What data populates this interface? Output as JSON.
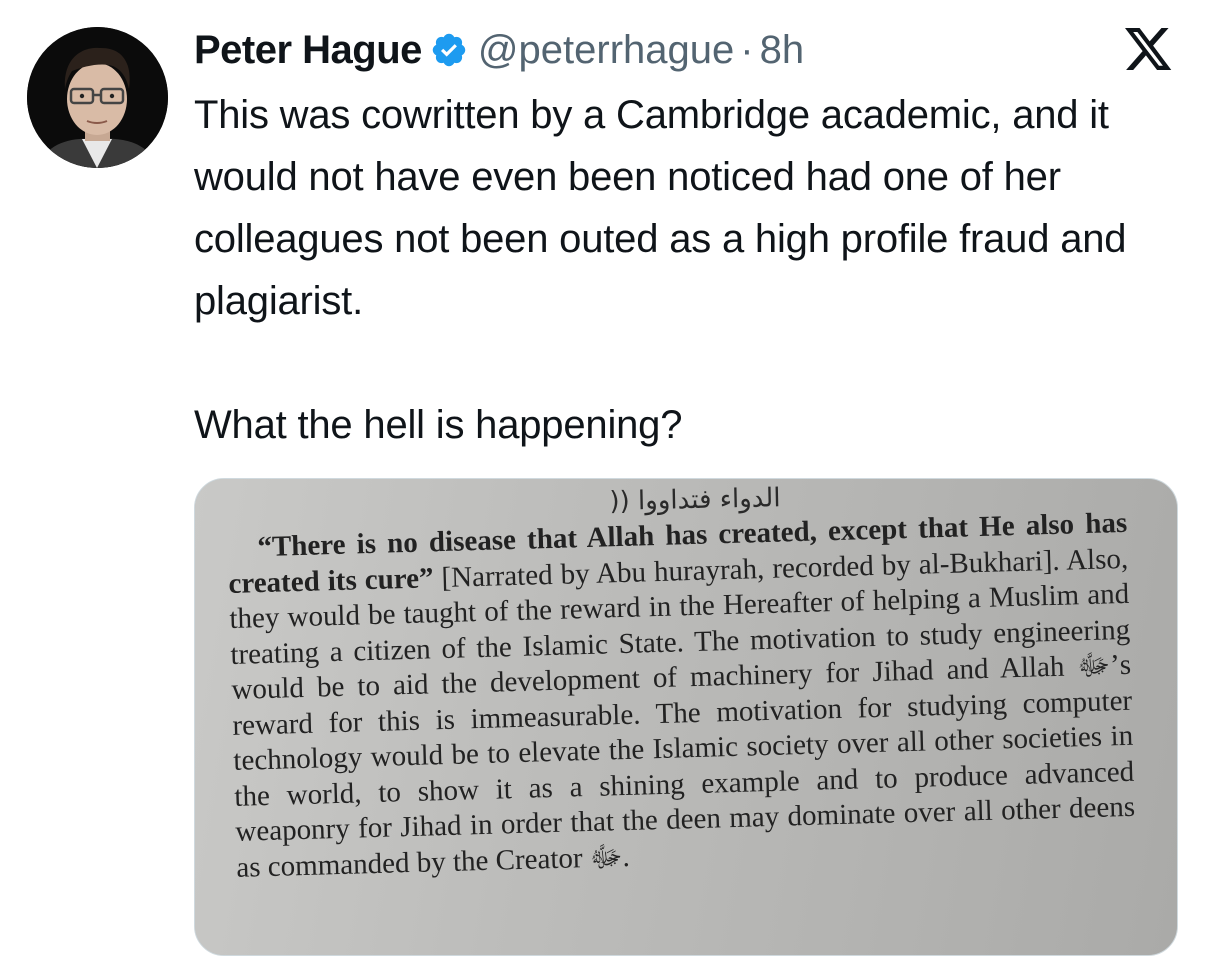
{
  "author": {
    "name": "Peter Hague",
    "handle": "@peterrhague",
    "separator": "·",
    "time": "8h"
  },
  "tweet": {
    "paragraph1": "This was cowritten by a Cambridge academic, and it would not have even been noticed had one of her colleagues not been outed as a high profile fraud and plagiarist.",
    "paragraph2": "What the hell is happening?"
  },
  "media": {
    "arabic_line": "الدواء فتداووا ((",
    "quote_bold": "“There is no disease that Allah has created, except that He also has created its cure”",
    "body": " [Narrated by Abu hurayrah, recorded by al-Bukhari]. Also, they would be taught of the reward in the Hereafter of helping a Muslim and treating a citizen of the Islamic State. The motivation to study engineering would be to aid the development of machinery for Jihad and Allah ﷻ’s reward for this is immeasurable. The motivation for studying computer technology would be to elevate the Islamic society over all other societies in the world, to show it as a shining example and to produce advanced weaponry for Jihad in order that the deen may dominate over all other deens as commanded by the Creator ﷻ."
  },
  "icons": {
    "verified": "verified-badge-icon",
    "platform": "x-logo-icon"
  },
  "colors": {
    "verified_blue": "#1d9bf0",
    "text": "#0f1419",
    "secondary": "#536471"
  }
}
